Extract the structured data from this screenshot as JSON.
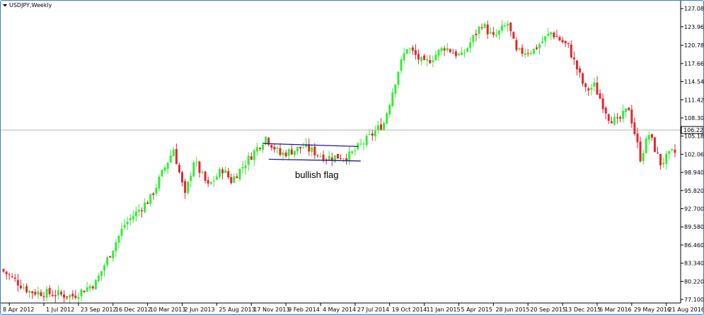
{
  "window": {
    "title": "USDJPY,Weekly"
  },
  "chart_data": {
    "type": "candlestick",
    "title": "USDJPY,Weekly",
    "ylim": [
      76.5,
      128.2
    ],
    "y_ticks": [
      "127.080",
      "123.960",
      "120.780",
      "117.660",
      "114.540",
      "111.420",
      "108.300",
      "105.180",
      "102.060",
      "98.940",
      "95.820",
      "92.700",
      "89.580",
      "86.460",
      "83.340",
      "80.220",
      "77.100"
    ],
    "x_ticks": [
      "8 Apr 2012",
      "1 Jul 2012",
      "23 Sep 2012",
      "16 Dec 2012",
      "10 Mar 2013",
      "2 Jun 2013",
      "25 Aug 2013",
      "17 Nov 2013",
      "9 Feb 2014",
      "4 May 2014",
      "27 Jul 2014",
      "19 Oct 2014",
      "11 Jan 2015",
      "5 Apr 2015",
      "28 Jun 2015",
      "20 Sep 2015",
      "13 Dec 2015",
      "6 Mar 2016",
      "29 May 2016",
      "21 Aug 2016"
    ],
    "current_price": {
      "label": "106.221",
      "value": 106.221
    },
    "colors": {
      "up": "#33ee33",
      "down": "#e8242e",
      "trendline": "#1a1aa8",
      "price_line": "#b4b4b4",
      "axis": "#000000"
    },
    "annotation": {
      "text": "bullish flag"
    },
    "flag_lines": [
      {
        "from": [
          "2013-12-15",
          103.9
        ],
        "to": [
          "2014-08-03",
          103.4
        ]
      },
      {
        "from": [
          "2013-12-29",
          101.2
        ],
        "to": [
          "2014-08-10",
          100.9
        ]
      }
    ],
    "keypoints": [
      [
        "2012-03-25",
        82.3
      ],
      [
        "2012-06-03",
        78.5
      ],
      [
        "2012-09-16",
        77.7
      ],
      [
        "2012-11-11",
        80.0
      ],
      [
        "2013-01-20",
        90.0
      ],
      [
        "2013-03-24",
        94.5
      ],
      [
        "2013-05-19",
        103.0
      ],
      [
        "2013-06-16",
        94.8
      ],
      [
        "2013-07-07",
        101.0
      ],
      [
        "2013-08-11",
        96.5
      ],
      [
        "2013-09-15",
        99.5
      ],
      [
        "2013-10-06",
        97.5
      ],
      [
        "2013-12-29",
        105.0
      ],
      [
        "2014-02-02",
        102.0
      ],
      [
        "2014-03-30",
        103.3
      ],
      [
        "2014-05-25",
        101.5
      ],
      [
        "2014-07-20",
        101.8
      ],
      [
        "2014-08-31",
        104.5
      ],
      [
        "2014-10-12",
        107.5
      ],
      [
        "2014-11-16",
        116.5
      ],
      [
        "2014-12-07",
        120.5
      ],
      [
        "2015-01-18",
        117.5
      ],
      [
        "2015-03-08",
        120.5
      ],
      [
        "2015-04-19",
        118.8
      ],
      [
        "2015-06-07",
        124.5
      ],
      [
        "2015-07-05",
        122.0
      ],
      [
        "2015-08-09",
        124.5
      ],
      [
        "2015-08-30",
        119.5
      ],
      [
        "2015-10-11",
        120.0
      ],
      [
        "2015-11-22",
        123.0
      ],
      [
        "2016-01-03",
        120.5
      ],
      [
        "2016-02-14",
        113.0
      ],
      [
        "2016-03-06",
        113.8
      ],
      [
        "2016-04-10",
        108.5
      ],
      [
        "2016-05-01",
        107.5
      ],
      [
        "2016-05-29",
        110.0
      ],
      [
        "2016-06-26",
        101.5
      ],
      [
        "2016-07-17",
        105.5
      ],
      [
        "2016-08-14",
        100.5
      ],
      [
        "2016-09-11",
        102.3
      ]
    ]
  }
}
